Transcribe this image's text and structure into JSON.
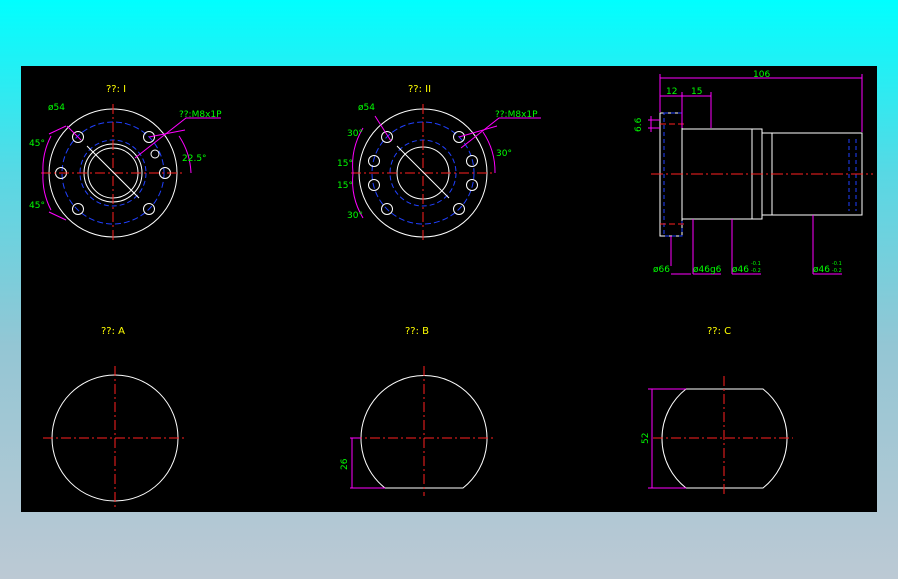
{
  "colors": {
    "background": "#000000",
    "outline": "#ffffff",
    "centerline": "#ff2020",
    "hidden": "#2040ff",
    "dimension": "#ff00ff",
    "text": "#00ff00",
    "title_text": "#ffff00"
  },
  "view_I": {
    "title": "??: I",
    "dia_pcd": "ø54",
    "thread": "??:M8x1P",
    "angle_top": "45°",
    "angle_bottom": "45°",
    "angle_right": "22.5°"
  },
  "view_II": {
    "title": "??: II",
    "dia_pcd": "ø54",
    "thread": "??:M8x1P",
    "angle_1": "30°",
    "angle_2": "15°",
    "angle_3": "15°",
    "angle_4": "30°",
    "angle_right": "30°"
  },
  "side_view": {
    "dim_total": "106",
    "dim_12": "12",
    "dim_15": "15",
    "dim_66v": "6.6",
    "dia_flange": "ø66",
    "dia_g6": "ø46g6",
    "dia_tol1": "ø46",
    "tol1_upper": "-0.1",
    "tol1_lower": "-0.2",
    "dia_tol2": "ø46",
    "tol2_upper": "-0.1",
    "tol2_lower": "-0.2"
  },
  "view_A": {
    "title": "??: A"
  },
  "view_B": {
    "title": "??: B",
    "dim_flat": "26"
  },
  "view_C": {
    "title": "??: C",
    "dim_width": "52"
  }
}
